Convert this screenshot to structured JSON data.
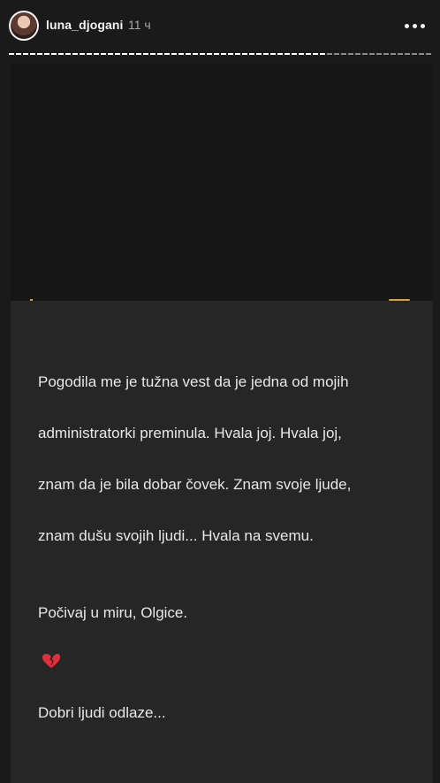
{
  "header": {
    "username": "luna_djogani",
    "time": "11 ч",
    "more_icon": "more-horizontal-icon",
    "avatar_icon": "profile-avatar"
  },
  "story": {
    "progress": 0.75,
    "caption_line1": "Pogodila me je tužna vest da je jedna od mojih",
    "caption_line2": "administratorki preminula. Hvala joj. Hvala joj,",
    "caption_line3": "znam da je bila dobar čovek. Znam svoje ljude,",
    "caption_line4": "znam dušu svojih ljudi... Hvala na svemu.",
    "caption_line5": "Počivaj u miru, Olgice.",
    "caption_line6": "Dobri ljudi odlaze...",
    "emoji": "broken-heart-icon"
  },
  "colors": {
    "background": "#1a1a1a",
    "accent": "#d6a233",
    "heart": "#e0313a"
  }
}
